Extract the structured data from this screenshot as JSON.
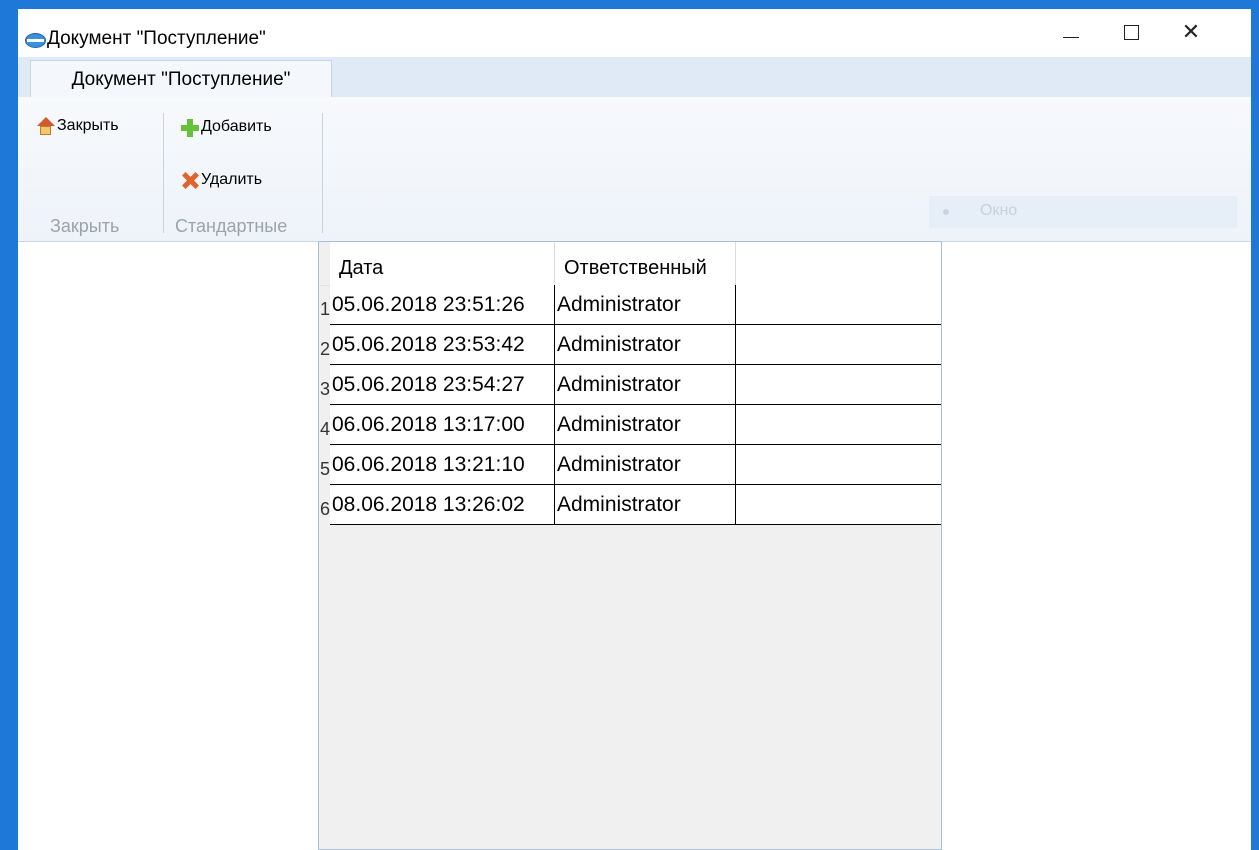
{
  "window": {
    "title": "Документ \"Поступление\"",
    "controls": {
      "minimize": "—",
      "maximize": "☐",
      "close": "✕"
    }
  },
  "tab": {
    "label": "Документ \"Поступление\""
  },
  "ribbon": {
    "close_label": "Закрыть",
    "add_label": "Добавить",
    "delete_label": "Удалить",
    "group_close": "Закрыть",
    "group_standard": "Стандартные",
    "window_label": "Окно"
  },
  "grid": {
    "columns": [
      "Дата",
      "Ответственный"
    ],
    "rows": [
      {
        "num": "1",
        "date": "05.06.2018 23:51:26",
        "user": "Administrator"
      },
      {
        "num": "2",
        "date": "05.06.2018 23:53:42",
        "user": "Administrator"
      },
      {
        "num": "3",
        "date": "05.06.2018 23:54:27",
        "user": "Administrator"
      },
      {
        "num": "4",
        "date": "06.06.2018 13:17:00",
        "user": "Administrator"
      },
      {
        "num": "5",
        "date": "06.06.2018 13:21:10",
        "user": "Administrator"
      },
      {
        "num": "6",
        "date": "08.06.2018 13:26:02",
        "user": "Administrator"
      }
    ]
  },
  "colors": {
    "accent": "#1e78d7",
    "tab_strip": "#dfeaf6",
    "add_icon": "#66c23a",
    "delete_icon": "#e0632b"
  },
  "icons": {
    "app": "app-logo-icon",
    "close": "house-icon",
    "add": "plus-icon",
    "delete": "delete-x-icon"
  }
}
